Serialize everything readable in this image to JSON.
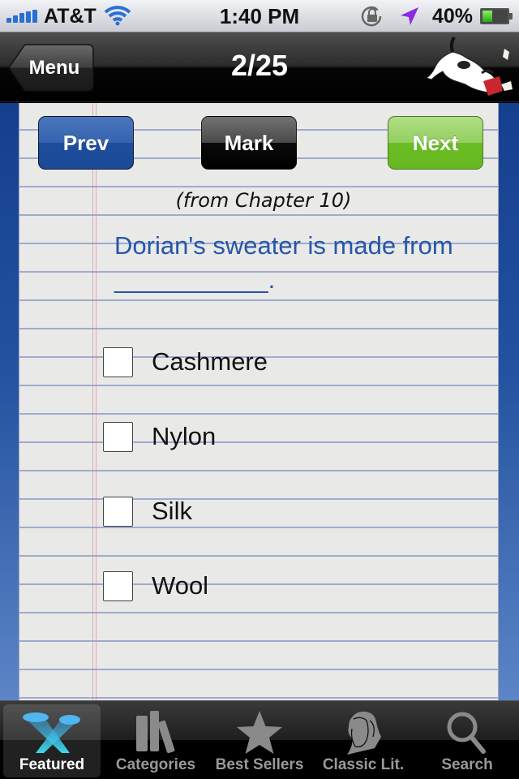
{
  "status_bar": {
    "carrier": "AT&T",
    "time": "1:40 PM",
    "battery_percent_label": "40%",
    "battery_level": 0.4,
    "icons": [
      "signal-bars-icon",
      "wifi-icon",
      "rotation-lock-icon",
      "location-arrow-icon",
      "battery-icon"
    ]
  },
  "nav_bar": {
    "back_label": "Menu",
    "title": "2/25",
    "logo": "dog-mascot-logo"
  },
  "quiz": {
    "buttons": {
      "prev_label": "Prev",
      "mark_label": "Mark",
      "next_label": "Next"
    },
    "source": "(from Chapter 10)",
    "question": "Dorian's sweater is made from ___________.",
    "options": [
      {
        "label": "Cashmere",
        "checked": false
      },
      {
        "label": "Nylon",
        "checked": false
      },
      {
        "label": "Silk",
        "checked": false
      },
      {
        "label": "Wool",
        "checked": false
      }
    ]
  },
  "tab_bar": {
    "tabs": [
      {
        "label": "Featured",
        "icon": "featured-spotlight-icon",
        "active": true
      },
      {
        "label": "Categories",
        "icon": "books-icon",
        "active": false
      },
      {
        "label": "Best Sellers",
        "icon": "star-icon",
        "active": false
      },
      {
        "label": "Classic Lit.",
        "icon": "shakespeare-head-icon",
        "active": false
      },
      {
        "label": "Search",
        "icon": "search-icon",
        "active": false
      }
    ]
  },
  "colors": {
    "prev_button": "#1d4d9c",
    "mark_button": "#000000",
    "next_button": "#6cbd24",
    "question_text": "#2656a8",
    "side_border_top": "#143f8e",
    "side_border_bottom": "#5b85c6"
  }
}
